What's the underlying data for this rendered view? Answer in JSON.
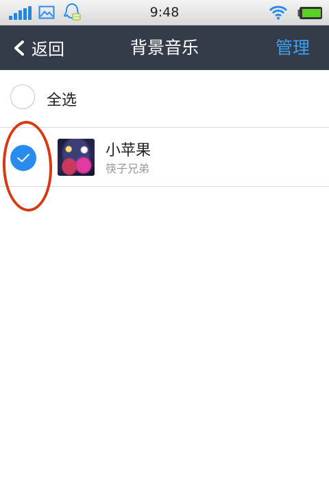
{
  "status_bar": {
    "time": "9:48",
    "icons": [
      "signal-icon",
      "image-icon",
      "qq-icon",
      "wifi-icon",
      "battery-icon"
    ]
  },
  "nav": {
    "back_label": "返回",
    "title": "背景音乐",
    "manage_label": "管理"
  },
  "select_all": {
    "label": "全选",
    "checked": false
  },
  "songs": [
    {
      "title": "小苹果",
      "artist": "筷子兄弟",
      "checked": true
    }
  ],
  "colors": {
    "nav_background": "#333c48",
    "accent": "#2a8bef",
    "manage_text": "#3aa0f2",
    "annotation": "#d63a12"
  }
}
